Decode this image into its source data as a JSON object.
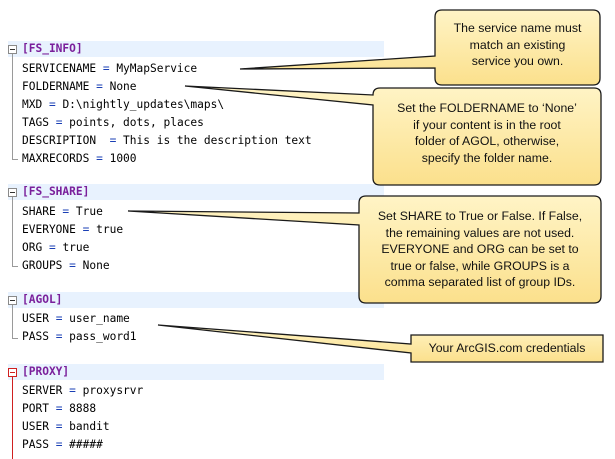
{
  "sections": [
    {
      "header": "[FS_INFO]",
      "lines": [
        {
          "key": "SERVICENAME",
          "sep": " = ",
          "value": "MyMapService"
        },
        {
          "key": "FOLDERNAME",
          "sep": " = ",
          "value": "None"
        },
        {
          "key": "MXD",
          "sep": " = ",
          "value": "D:\\nightly_updates\\maps\\"
        },
        {
          "key": "TAGS",
          "sep": " = ",
          "value": "points, dots, places"
        },
        {
          "key": "DESCRIPTION",
          "sep": "  = ",
          "value": "This is the description text"
        },
        {
          "key": "MAXRECORDS",
          "sep": " = ",
          "value": "1000"
        }
      ]
    },
    {
      "header": "[FS_SHARE]",
      "lines": [
        {
          "key": "SHARE",
          "sep": " = ",
          "value": "True"
        },
        {
          "key": "EVERYONE",
          "sep": " = ",
          "value": "true"
        },
        {
          "key": "ORG",
          "sep": " = ",
          "value": "true"
        },
        {
          "key": "GROUPS",
          "sep": " = ",
          "value": "None"
        }
      ]
    },
    {
      "header": "[AGOL]",
      "lines": [
        {
          "key": "USER",
          "sep": " = ",
          "value": "user_name"
        },
        {
          "key": "PASS",
          "sep": " = ",
          "value": "pass_word1"
        }
      ]
    },
    {
      "header": "[PROXY]",
      "lines": [
        {
          "key": "SERVER",
          "sep": " = ",
          "value": "proxysrvr"
        },
        {
          "key": "PORT",
          "sep": " = ",
          "value": "8888"
        },
        {
          "key": "USER",
          "sep": " = ",
          "value": "bandit"
        },
        {
          "key": "PASS",
          "sep": " = ",
          "value": "#####"
        }
      ]
    }
  ],
  "callouts": [
    {
      "lines": [
        "The service name must",
        "match an existing",
        "service you own."
      ]
    },
    {
      "lines": [
        "Set the FOLDERNAME to ‘None’",
        "if your content is in the root",
        "folder of AGOL, otherwise,",
        "specify the folder name."
      ]
    },
    {
      "lines": [
        "Set SHARE to True or False. If False,",
        "the remaining values are not used.",
        "EVERYONE and ORG can be set to",
        "true or false, while GROUPS is a",
        "comma separated list of group IDs."
      ]
    },
    {
      "lines": [
        "Your ArcGIS.com credentials"
      ]
    }
  ],
  "colors": {
    "callout_fill": "#fde9a8",
    "callout_border": "#1a1a1a",
    "header_text": "#7a1f9b",
    "operator": "#1a3fb5",
    "section_highlight": "#e8f2fe"
  }
}
